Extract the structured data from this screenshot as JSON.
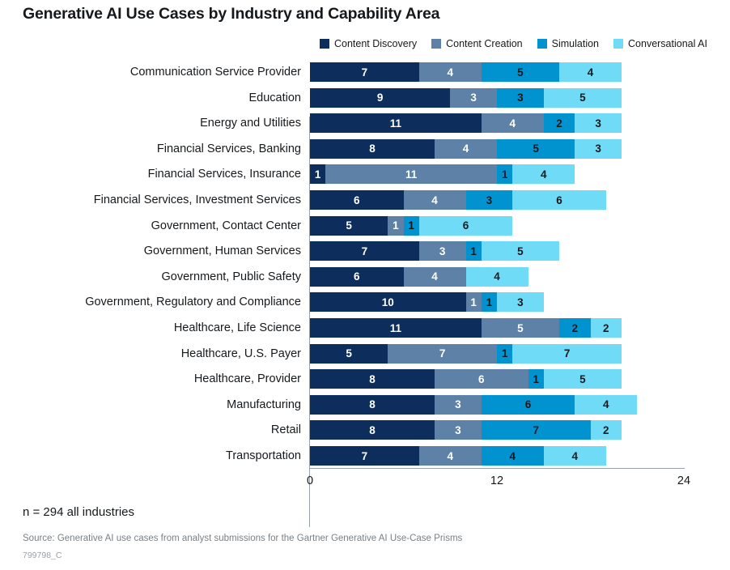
{
  "title": "Generative AI Use Cases by Industry and Capability Area",
  "footer": {
    "n_note": "n = 294 all industries",
    "source": "Source: Generative AI use cases from analyst submissions for the Gartner Generative AI Use-Case Prisms",
    "chart_id": "799798_C"
  },
  "colors": {
    "content_discovery": "#0D2E5C",
    "content_creation": "#5E81A8",
    "simulation": "#0093D0",
    "conversational_ai": "#6FDBF7",
    "axis": "#9aa0a6",
    "text": "#16191c",
    "muted_text": "#7a8085"
  },
  "chart_data": {
    "type": "bar",
    "orientation": "horizontal",
    "stacked": true,
    "title": "Generative AI Use Cases by Industry and Capability Area",
    "xlabel": "",
    "ylabel": "",
    "xlim": [
      0,
      24
    ],
    "xticks": [
      0,
      12,
      24
    ],
    "xtick_labels": [
      "0",
      "12",
      "24"
    ],
    "grid": false,
    "legend_position": "top-right",
    "show_bar_labels": true,
    "categories": [
      "Communication Service Provider",
      "Education",
      "Energy and Utilities",
      "Financial Services, Banking",
      "Financial Services, Insurance",
      "Financial Services, Investment Services",
      "Government, Contact Center",
      "Government, Human Services",
      "Government, Public Safety",
      "Government, Regulatory and Compliance",
      "Healthcare, Life Science",
      "Healthcare, U.S. Payer",
      "Healthcare, Provider",
      "Manufacturing",
      "Retail",
      "Transportation"
    ],
    "series": [
      {
        "name": "Content Discovery",
        "color": "#0D2E5C",
        "label_color": "light",
        "values": [
          7,
          9,
          11,
          8,
          1,
          6,
          5,
          7,
          6,
          10,
          11,
          5,
          8,
          8,
          8,
          7
        ]
      },
      {
        "name": "Content Creation",
        "color": "#5E81A8",
        "label_color": "light",
        "values": [
          4,
          3,
          4,
          4,
          11,
          4,
          1,
          3,
          4,
          1,
          5,
          7,
          6,
          3,
          3,
          4
        ]
      },
      {
        "name": "Simulation",
        "color": "#0093D0",
        "label_color": "dark",
        "values": [
          5,
          3,
          2,
          5,
          1,
          3,
          1,
          1,
          0,
          1,
          2,
          1,
          1,
          6,
          7,
          4
        ]
      },
      {
        "name": "Conversational AI",
        "color": "#6FDBF7",
        "label_color": "dark",
        "values": [
          4,
          5,
          3,
          3,
          4,
          6,
          6,
          5,
          4,
          3,
          2,
          7,
          5,
          4,
          2,
          4
        ]
      }
    ],
    "row_totals": [
      20,
      20,
      20,
      20,
      17,
      19,
      13,
      16,
      14,
      15,
      20,
      20,
      20,
      21,
      20,
      19
    ]
  }
}
